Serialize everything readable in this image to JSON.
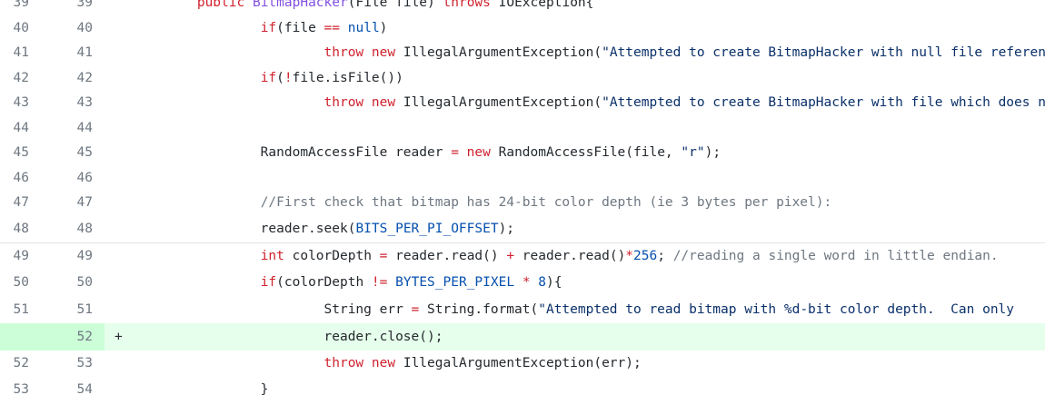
{
  "lines": [
    {
      "old": "39",
      "new": "39",
      "marker": "",
      "added": false,
      "tokens": [
        {
          "t": "txt",
          "v": "        "
        },
        {
          "t": "kw",
          "v": "public"
        },
        {
          "t": "txt",
          "v": " "
        },
        {
          "t": "fn",
          "v": "BitmapHacker"
        },
        {
          "t": "txt",
          "v": "(File file) "
        },
        {
          "t": "kw",
          "v": "throws"
        },
        {
          "t": "txt",
          "v": " IOException{"
        }
      ]
    },
    {
      "old": "40",
      "new": "40",
      "marker": "",
      "added": false,
      "tokens": [
        {
          "t": "txt",
          "v": "                "
        },
        {
          "t": "kw",
          "v": "if"
        },
        {
          "t": "txt",
          "v": "(file "
        },
        {
          "t": "op",
          "v": "=="
        },
        {
          "t": "txt",
          "v": " "
        },
        {
          "t": "cn",
          "v": "null"
        },
        {
          "t": "txt",
          "v": ")"
        }
      ]
    },
    {
      "old": "41",
      "new": "41",
      "marker": "",
      "added": false,
      "tokens": [
        {
          "t": "txt",
          "v": "                        "
        },
        {
          "t": "kw",
          "v": "throw"
        },
        {
          "t": "txt",
          "v": " "
        },
        {
          "t": "kw",
          "v": "new"
        },
        {
          "t": "txt",
          "v": " IllegalArgumentException("
        },
        {
          "t": "str",
          "v": "\"Attempted to create BitmapHacker with null file reference\""
        }
      ]
    },
    {
      "old": "42",
      "new": "42",
      "marker": "",
      "added": false,
      "tokens": [
        {
          "t": "txt",
          "v": "                "
        },
        {
          "t": "kw",
          "v": "if"
        },
        {
          "t": "txt",
          "v": "("
        },
        {
          "t": "op",
          "v": "!"
        },
        {
          "t": "txt",
          "v": "file.isFile())"
        }
      ]
    },
    {
      "old": "43",
      "new": "43",
      "marker": "",
      "added": false,
      "tokens": [
        {
          "t": "txt",
          "v": "                        "
        },
        {
          "t": "kw",
          "v": "throw"
        },
        {
          "t": "txt",
          "v": " "
        },
        {
          "t": "kw",
          "v": "new"
        },
        {
          "t": "txt",
          "v": " IllegalArgumentException("
        },
        {
          "t": "str",
          "v": "\"Attempted to create BitmapHacker with file which does not exist\""
        }
      ]
    },
    {
      "old": "44",
      "new": "44",
      "marker": "",
      "added": false,
      "tokens": []
    },
    {
      "old": "45",
      "new": "45",
      "marker": "",
      "added": false,
      "tokens": [
        {
          "t": "txt",
          "v": "                RandomAccessFile reader "
        },
        {
          "t": "op",
          "v": "="
        },
        {
          "t": "txt",
          "v": " "
        },
        {
          "t": "kw",
          "v": "new"
        },
        {
          "t": "txt",
          "v": " RandomAccessFile(file, "
        },
        {
          "t": "str",
          "v": "\"r\""
        },
        {
          "t": "txt",
          "v": ");"
        }
      ]
    },
    {
      "old": "46",
      "new": "46",
      "marker": "",
      "added": false,
      "tokens": []
    },
    {
      "old": "47",
      "new": "47",
      "marker": "",
      "added": false,
      "tokens": [
        {
          "t": "txt",
          "v": "                "
        },
        {
          "t": "cm",
          "v": "//First check that bitmap has 24-bit color depth (ie 3 bytes per pixel):"
        }
      ]
    },
    {
      "old": "48",
      "new": "48",
      "marker": "",
      "added": false,
      "tokens": [
        {
          "t": "txt",
          "v": "                reader.seek("
        },
        {
          "t": "cn",
          "v": "BITS_PER_PI_OFFSET"
        },
        {
          "t": "txt",
          "v": ");"
        }
      ]
    },
    {
      "old": "49",
      "new": "49",
      "marker": "",
      "added": false,
      "tokens": [
        {
          "t": "txt",
          "v": "                "
        },
        {
          "t": "kw",
          "v": "int"
        },
        {
          "t": "txt",
          "v": " colorDepth "
        },
        {
          "t": "op",
          "v": "="
        },
        {
          "t": "txt",
          "v": " reader.read() "
        },
        {
          "t": "op",
          "v": "+"
        },
        {
          "t": "txt",
          "v": " reader.read()"
        },
        {
          "t": "op",
          "v": "*"
        },
        {
          "t": "cn",
          "v": "256"
        },
        {
          "t": "txt",
          "v": "; "
        },
        {
          "t": "cm",
          "v": "//reading a single word in little endian."
        }
      ]
    },
    {
      "old": "50",
      "new": "50",
      "marker": "",
      "added": false,
      "tokens": [
        {
          "t": "txt",
          "v": "                "
        },
        {
          "t": "kw",
          "v": "if"
        },
        {
          "t": "txt",
          "v": "(colorDepth "
        },
        {
          "t": "op",
          "v": "!="
        },
        {
          "t": "txt",
          "v": " "
        },
        {
          "t": "cn",
          "v": "BYTES_PER_PIXEL"
        },
        {
          "t": "txt",
          "v": " "
        },
        {
          "t": "op",
          "v": "*"
        },
        {
          "t": "txt",
          "v": " "
        },
        {
          "t": "cn",
          "v": "8"
        },
        {
          "t": "txt",
          "v": "){"
        }
      ]
    },
    {
      "old": "51",
      "new": "51",
      "marker": "",
      "added": false,
      "tokens": [
        {
          "t": "txt",
          "v": "                        String err "
        },
        {
          "t": "op",
          "v": "="
        },
        {
          "t": "txt",
          "v": " String.format("
        },
        {
          "t": "str",
          "v": "\"Attempted to read bitmap with %d-bit color depth.  Can only"
        }
      ]
    },
    {
      "old": "",
      "new": "52",
      "marker": "+",
      "added": true,
      "tokens": [
        {
          "t": "txt",
          "v": "                        reader.close();"
        }
      ]
    },
    {
      "old": "52",
      "new": "53",
      "marker": "",
      "added": false,
      "tokens": [
        {
          "t": "txt",
          "v": "                        "
        },
        {
          "t": "kw",
          "v": "throw"
        },
        {
          "t": "txt",
          "v": " "
        },
        {
          "t": "kw",
          "v": "new"
        },
        {
          "t": "txt",
          "v": " IllegalArgumentException(err);"
        }
      ]
    },
    {
      "old": "53",
      "new": "54",
      "marker": "",
      "added": false,
      "tokens": [
        {
          "t": "txt",
          "v": "                }"
        }
      ]
    }
  ]
}
